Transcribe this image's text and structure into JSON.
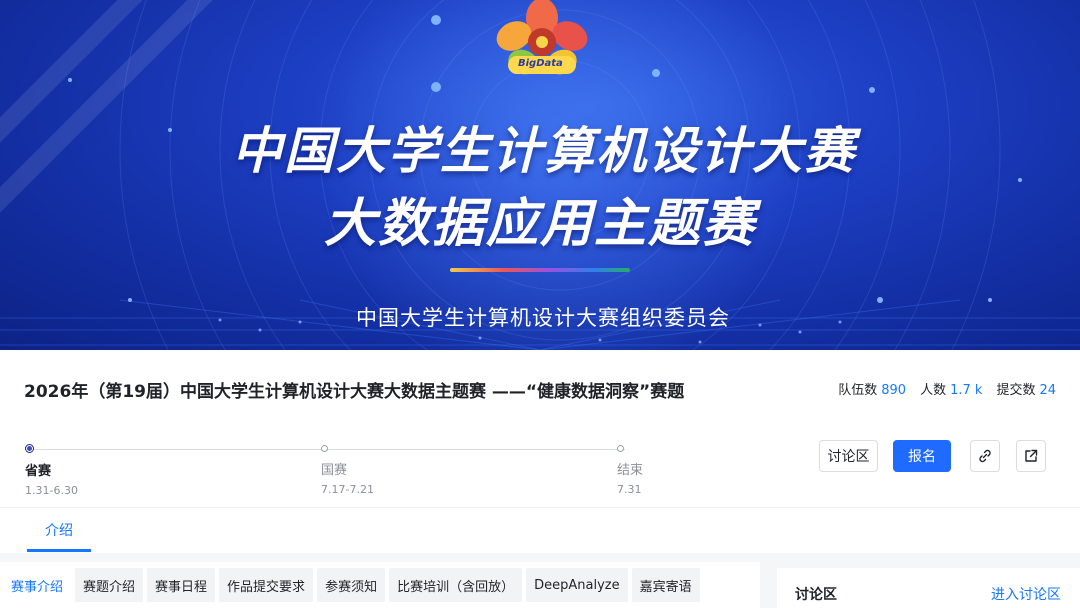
{
  "banner": {
    "logo_text": "BigData",
    "title_line1": "中国大学生计算机设计大赛",
    "title_line2": "大数据应用主题赛",
    "organizer": "中国大学生计算机设计大赛组织委员会"
  },
  "competition": {
    "title": "2026年（第19届）中国大学生计算机设计大赛大数据主题赛 ——“健康数据洞察”赛题",
    "stats": [
      {
        "label": "队伍数",
        "value": "890"
      },
      {
        "label": "人数",
        "value": "1.7 k"
      },
      {
        "label": "提交数",
        "value": "24"
      }
    ]
  },
  "timeline": [
    {
      "name": "省赛",
      "date": "1.31-6.30",
      "active": true
    },
    {
      "name": "国赛",
      "date": "7.17-7.21",
      "active": false
    },
    {
      "name": "结束",
      "date": "7.31",
      "active": false
    }
  ],
  "actions": {
    "discuss_label": "讨论区",
    "signup_label": "报名",
    "link_icon": "link-icon",
    "share_icon": "share-icon"
  },
  "main_tabs": [
    {
      "label": "介绍",
      "active": true
    }
  ],
  "sub_tabs": [
    {
      "label": "赛事介绍",
      "active": true
    },
    {
      "label": "赛题介绍",
      "active": false
    },
    {
      "label": "赛事日程",
      "active": false
    },
    {
      "label": "作品提交要求",
      "active": false
    },
    {
      "label": "参赛须知",
      "active": false
    },
    {
      "label": "比赛培训（含回放）",
      "active": false
    },
    {
      "label": "DeepAnalyze",
      "active": false
    },
    {
      "label": "嘉宾寄语",
      "active": false
    }
  ],
  "discussion_panel": {
    "heading": "讨论区",
    "enter_link": "进入讨论区"
  },
  "colors": {
    "accent": "#1677ff",
    "primary_button": "#1f6bff",
    "banner_blue": "#1d3fc4"
  }
}
